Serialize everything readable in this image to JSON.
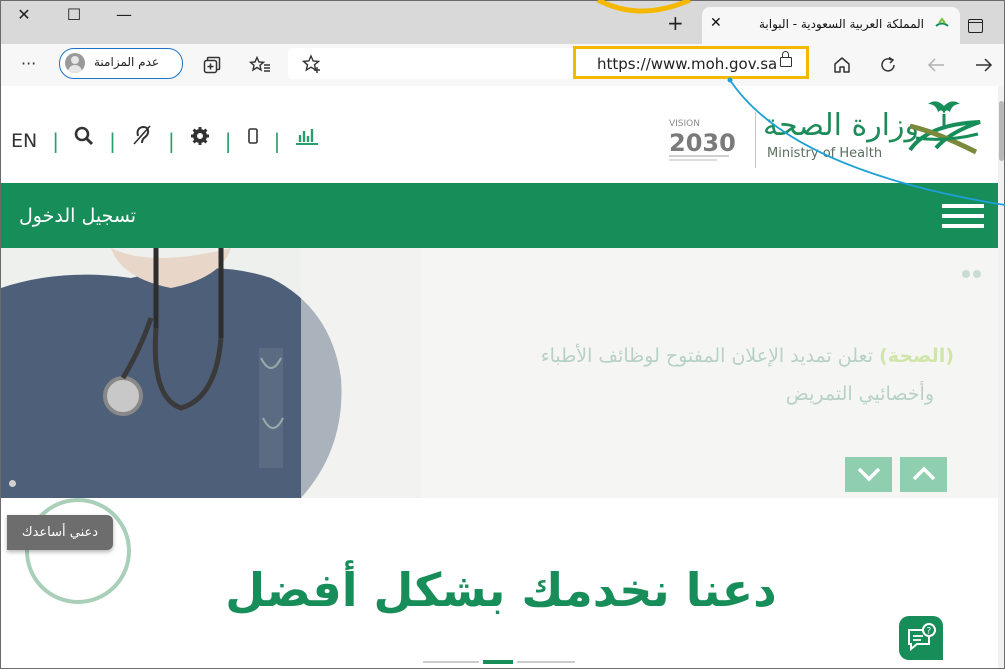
{
  "colors": {
    "brand_green": "#178d5a",
    "highlight": "#f5b800",
    "callout_line": "#1ca0d8"
  },
  "window": {
    "close_glyph": "✕",
    "maximize_glyph": "☐",
    "minimize_glyph": "—"
  },
  "tab": {
    "title": "المملكة العربية السعودية - البوابة",
    "close_glyph": "✕",
    "new_tab_glyph": "+"
  },
  "toolbar": {
    "more_glyph": "···",
    "profile_label": "عدم المزامنة",
    "url": "https://www.moh.gov.sa",
    "icons": [
      "more-icon",
      "collections-icon",
      "favorites-icon",
      "add-favorite-icon",
      "lock-icon",
      "home-icon",
      "refresh-icon",
      "back-icon",
      "forward-icon"
    ]
  },
  "site": {
    "lang_toggle": "EN",
    "ministry_ar": "وزارة الصحة",
    "ministry_en": "Ministry of Health",
    "vision_label": "VISION",
    "vision_year": "2030"
  },
  "menu": {
    "login_label": "تسجيل الدخول"
  },
  "hero": {
    "headline_highlight": "(الصحة)",
    "headline_rest": " تعلن تمديد الإعلان المفتوح لوظائف الأطباء",
    "headline_line2": "وأخصائيي التمريض"
  },
  "help": {
    "button_label": "دعني أساعدك"
  },
  "main": {
    "title": "دعنا نخدمك بشكل أفضل"
  }
}
